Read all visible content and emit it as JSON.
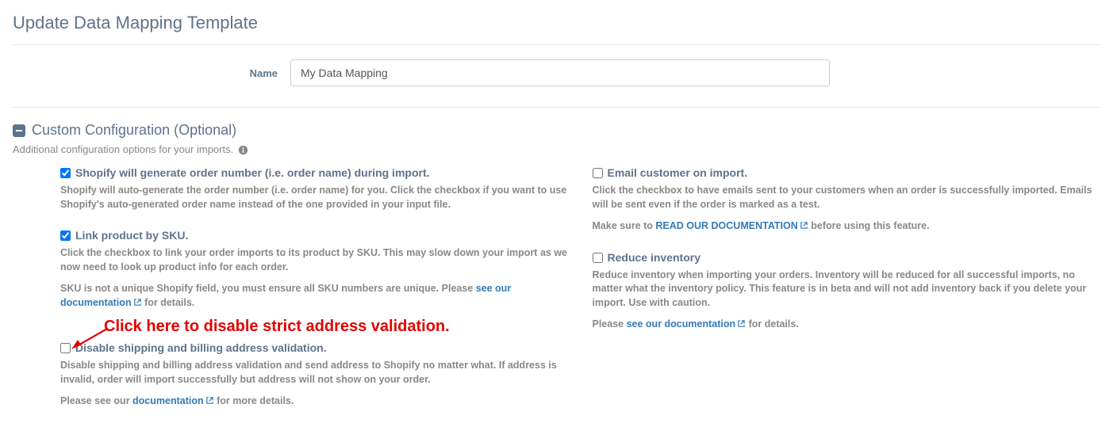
{
  "page_title": "Update Data Mapping Template",
  "name_field": {
    "label": "Name",
    "value": "My Data Mapping"
  },
  "custom_config": {
    "title": "Custom Configuration (Optional)",
    "desc": "Additional configuration options for your imports."
  },
  "annotation": "Click here to disable strict address validation.",
  "opts": {
    "gen_order": {
      "label": "Shopify will generate order number (i.e. order name) during import.",
      "desc": "Shopify will auto-generate the order number (i.e. order name) for you. Click the checkbox if you want to use Shopify's auto-generated order name instead of the one provided in your input file."
    },
    "link_sku": {
      "label": "Link product by SKU.",
      "desc1": "Click the checkbox to link your order imports to its product by SKU. This may slow down your import as we now need to look up product info for each order.",
      "desc2_before": "SKU is not a unique Shopify field, you must ensure all SKU numbers are unique. Please ",
      "link": "see our documentation",
      "desc2_after": " for details."
    },
    "disable_addr": {
      "label": "Disable shipping and billing address validation.",
      "desc1": "Disable shipping and billing address validation and send address to Shopify no matter what. If address is invalid, order will import successfully but address will not show on your order.",
      "desc2_before": "Please see our ",
      "link": "documentation",
      "desc2_after": " for more details."
    },
    "email_cust": {
      "label": "Email customer on import.",
      "desc1": "Click the checkbox to have emails sent to your customers when an order is successfully imported. Emails will be sent even if the order is marked as a test.",
      "desc2_before": "Make sure to ",
      "link": "READ OUR DOCUMENTATION",
      "desc2_after": " before using this feature."
    },
    "reduce_inv": {
      "label": "Reduce inventory",
      "desc1": "Reduce inventory when importing your orders. Inventory will be reduced for all successful imports, no matter what the inventory policy. This feature is in beta and will not add inventory back if you delete your import. Use with caution.",
      "desc2_before": "Please ",
      "link": "see our documentation",
      "desc2_after": " for details."
    }
  }
}
